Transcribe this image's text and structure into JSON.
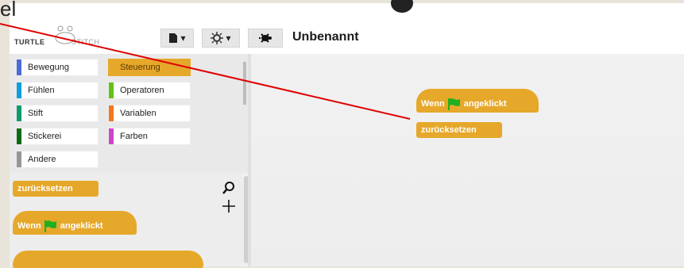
{
  "topbar": {
    "cut_text": "el"
  },
  "toolbar": {
    "logo_left": "TURTLE",
    "logo_right": "STITCH",
    "file_button": "▾",
    "settings_button": "▾",
    "project_title": "Unbenannt"
  },
  "categories": [
    {
      "label": "Bewegung",
      "color": "#4a6cd4",
      "selected": false
    },
    {
      "label": "Steuerung",
      "color": "#e6a82a",
      "selected": true
    },
    {
      "label": "Fühlen",
      "color": "#0e9fd8",
      "selected": false
    },
    {
      "label": "Operatoren",
      "color": "#62c213",
      "selected": false
    },
    {
      "label": "Stift",
      "color": "#0e9a6c",
      "selected": false
    },
    {
      "label": "Variablen",
      "color": "#f3761d",
      "selected": false
    },
    {
      "label": "Stickerei",
      "color": "#0b6b12",
      "selected": false
    },
    {
      "label": "Farben",
      "color": "#cc44cc",
      "selected": false
    },
    {
      "label": "Andere",
      "color": "#969696",
      "selected": false
    }
  ],
  "palette": {
    "block_reset": "zurücksetzen",
    "block_when_flag": "Wenn",
    "block_when_flag_suffix": "angeklickt"
  },
  "script": {
    "hat_prefix": "Wenn",
    "hat_suffix": "angeklickt",
    "command": "zurücksetzen"
  },
  "colors": {
    "control_block": "#e6a82a",
    "flag": "#1fb01f",
    "pointer_line": "#e00000"
  }
}
